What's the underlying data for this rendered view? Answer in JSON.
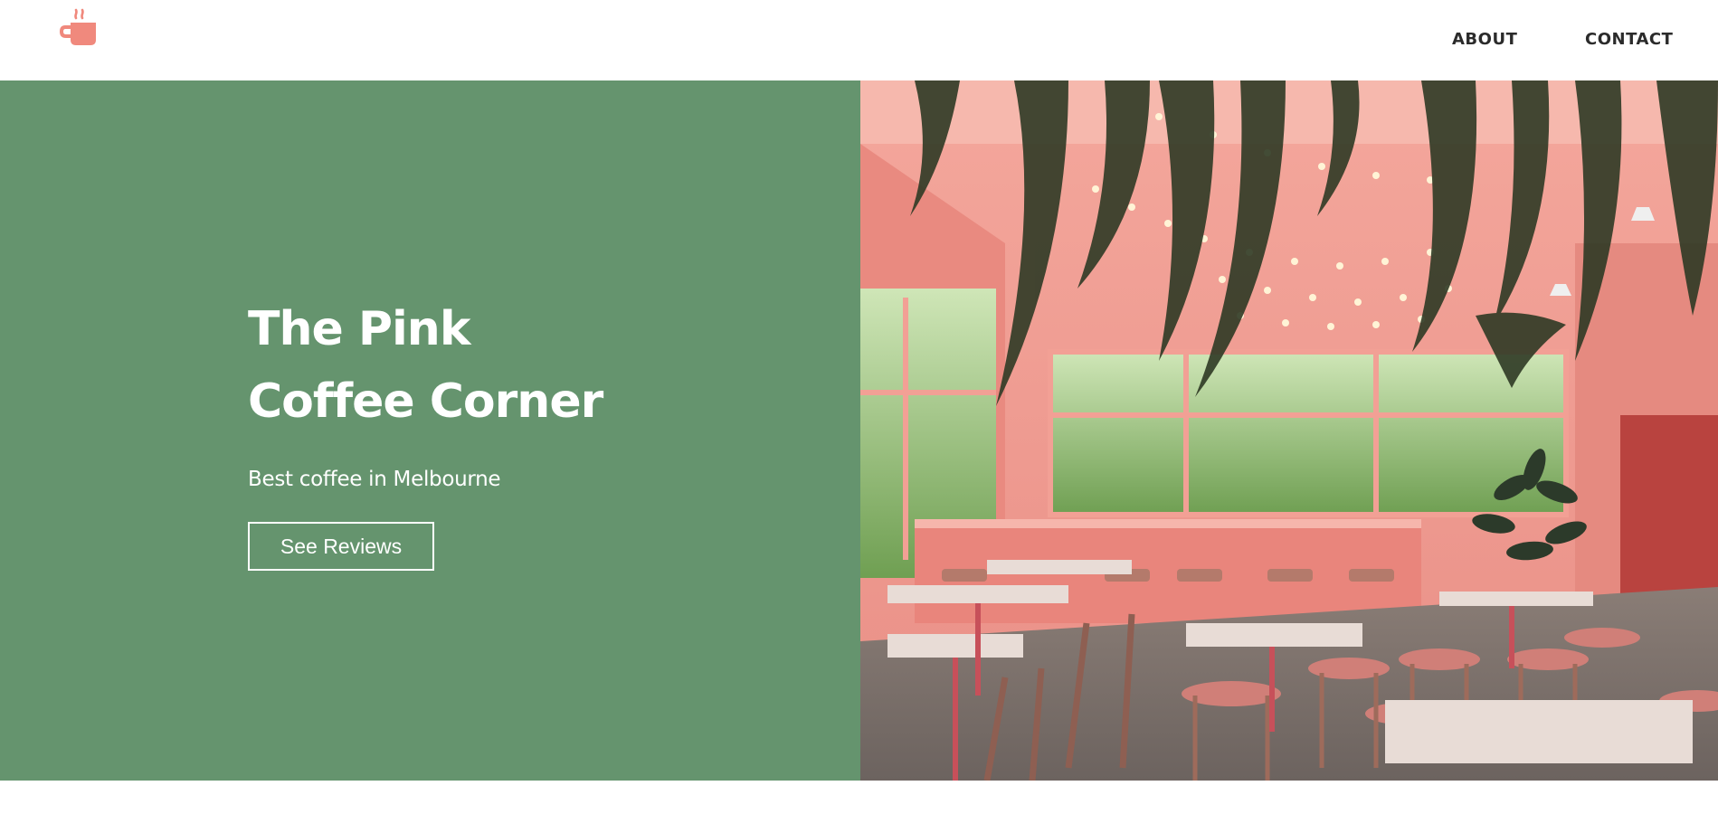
{
  "header": {
    "logo_icon": "coffee-cup-icon",
    "logo_color": "#f0897d",
    "nav": [
      {
        "label": "ABOUT"
      },
      {
        "label": "CONTACT"
      }
    ]
  },
  "hero": {
    "title_line1": "The Pink",
    "title_line2": "Coffee Corner",
    "subtitle": "Best coffee in Melbourne",
    "cta_label": "See Reviews",
    "panel_color": "#65946e",
    "photo_icon": "cafe-interior-photo"
  }
}
